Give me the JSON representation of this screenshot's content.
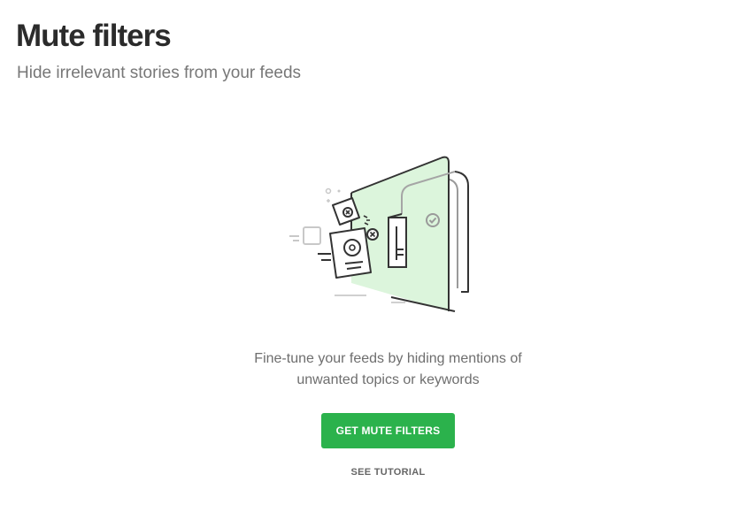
{
  "header": {
    "title": "Mute filters",
    "subtitle": "Hide irrelevant stories from your feeds"
  },
  "illustration": {
    "icon": "mute-filters-illustration",
    "accent_color": "#dcf5dc",
    "line_color": "#333333"
  },
  "empty_state": {
    "line1": "Fine-tune your feeds by hiding mentions of",
    "line2": "unwanted topics or keywords"
  },
  "actions": {
    "primary_label": "GET MUTE FILTERS",
    "primary_color": "#2bb24c",
    "secondary_label": "SEE TUTORIAL"
  }
}
